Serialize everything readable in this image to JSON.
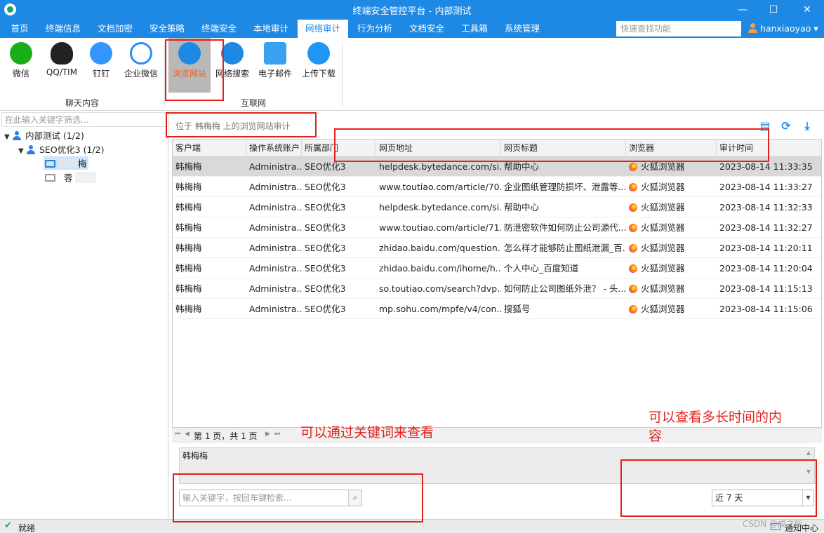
{
  "window": {
    "title": "终端安全管控平台 - 内部测试",
    "controls": {
      "minimize": "—",
      "maximize": "☐",
      "close": "✕"
    }
  },
  "menu": {
    "items": [
      "首页",
      "终端信息",
      "文档加密",
      "安全策略",
      "终端安全",
      "本地审计",
      "网络审计",
      "行为分析",
      "文档安全",
      "工具箱",
      "系统管理"
    ],
    "active": "网络审计",
    "quick_search_placeholder": "快速查找功能",
    "user": "hanxiaoyao",
    "user_arrow": "▾"
  },
  "ribbon": {
    "groups": [
      {
        "label": "聊天内容",
        "buttons": [
          {
            "label": "微信",
            "icon": "wechat-icon",
            "color": "#1aad19"
          },
          {
            "label": "QQ/TIM",
            "icon": "qq-icon",
            "color": "#222222"
          },
          {
            "label": "钉钉",
            "icon": "dingtalk-icon",
            "color": "#3296fa"
          },
          {
            "label": "企业微信",
            "icon": "wecom-icon",
            "color": "#2f8ef5"
          }
        ]
      },
      {
        "label": "互联网",
        "buttons": [
          {
            "label": "浏览网站",
            "icon": "globe-icon",
            "color": "#1e88e5",
            "selected": true
          },
          {
            "label": "网络搜索",
            "icon": "search-globe-icon",
            "color": "#1e88e5"
          },
          {
            "label": "电子邮件",
            "icon": "mail-icon",
            "color": "#3aa0f0"
          },
          {
            "label": "上传下载",
            "icon": "cloud-transfer-icon",
            "color": "#2196f3"
          }
        ]
      }
    ]
  },
  "tree": {
    "filter_placeholder": "在此输入关键字筛选...",
    "nodes": [
      {
        "label": "内部测试 (1/2)",
        "arrow": "▼"
      },
      {
        "label": "SEO优化3 (1/2)",
        "arrow": "▼"
      },
      {
        "label": "梅"
      },
      {
        "label": "蓉"
      }
    ]
  },
  "audit": {
    "location": "位于 韩梅梅 上的浏览网站审计",
    "tools": {
      "layout": "▤",
      "refresh": "⟳",
      "export": "⤓"
    },
    "columns": [
      "客户端",
      "操作系统账户",
      "所属部门",
      "网页地址",
      "网页标题",
      "浏览器",
      "审计时间"
    ],
    "rows": [
      [
        "韩梅梅",
        "Administra...",
        "SEO优化3",
        "helpdesk.bytedance.com/si...",
        "帮助中心",
        "火狐浏览器",
        "2023-08-14 11:33:35"
      ],
      [
        "韩梅梅",
        "Administra...",
        "SEO优化3",
        "www.toutiao.com/article/70...",
        "企业图纸管理防损坏、泄露等...",
        "火狐浏览器",
        "2023-08-14 11:33:27"
      ],
      [
        "韩梅梅",
        "Administra...",
        "SEO优化3",
        "helpdesk.bytedance.com/si...",
        "帮助中心",
        "火狐浏览器",
        "2023-08-14 11:32:33"
      ],
      [
        "韩梅梅",
        "Administra...",
        "SEO优化3",
        "www.toutiao.com/article/71...",
        "防泄密软件如何防止公司源代...",
        "火狐浏览器",
        "2023-08-14 11:32:27"
      ],
      [
        "韩梅梅",
        "Administra...",
        "SEO优化3",
        "zhidao.baidu.com/question...",
        "怎么样才能够防止图纸泄漏_百...",
        "火狐浏览器",
        "2023-08-14 11:20:11"
      ],
      [
        "韩梅梅",
        "Administra...",
        "SEO优化3",
        "zhidao.baidu.com/ihome/h...",
        "个人中心_百度知道",
        "火狐浏览器",
        "2023-08-14 11:20:04"
      ],
      [
        "韩梅梅",
        "Administra...",
        "SEO优化3",
        "so.toutiao.com/search?dvp...",
        "如何防止公司图纸外泄？ - 头...",
        "火狐浏览器",
        "2023-08-14 11:15:13"
      ],
      [
        "韩梅梅",
        "Administra...",
        "SEO优化3",
        "mp.sohu.com/mpfe/v4/con...",
        "搜狐号",
        "火狐浏览器",
        "2023-08-14 11:15:06"
      ]
    ],
    "pager": {
      "first": "⏮",
      "prev": "◀",
      "text": "第 1 页，共 1 页",
      "next": "▶",
      "last": "⏭"
    },
    "detail_text": "韩梅梅",
    "keyword_placeholder": "输入关键字，按回车键检索...",
    "range_value": "近 7 天"
  },
  "annotations": {
    "keyword_note": "可以通过关键词来查看",
    "range_note_line1": "可以查看多长时间的内",
    "range_note_line2": "容"
  },
  "status": {
    "text": "就绪",
    "notify": "通知中心",
    "watermark": "CSDN @成之所"
  }
}
